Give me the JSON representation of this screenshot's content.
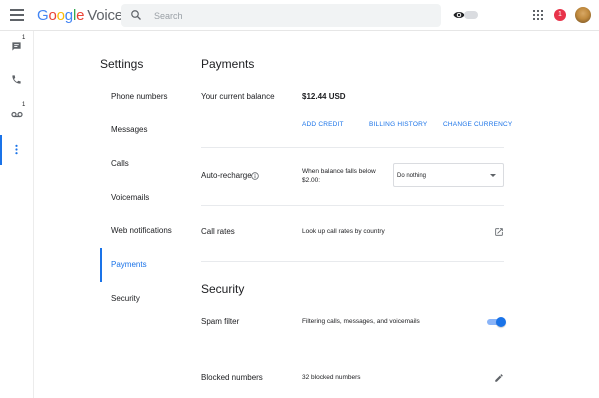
{
  "app": {
    "logo_letters": [
      "G",
      "o",
      "o",
      "g",
      "l",
      "e"
    ],
    "product": "Voice"
  },
  "search": {
    "placeholder": "Search"
  },
  "header": {
    "notification_count": "1"
  },
  "rail": {
    "messages_count": "1",
    "voicemail_count": "1"
  },
  "settings": {
    "title": "Settings",
    "nav": [
      "Phone numbers",
      "Messages",
      "Calls",
      "Voicemails",
      "Web notifications",
      "Payments",
      "Security"
    ],
    "active": "Payments"
  },
  "payments": {
    "title": "Payments",
    "balance_label": "Your current balance",
    "balance_value": "$12.44 USD",
    "links": {
      "add_credit": "ADD CREDIT",
      "billing_history": "BILLING HISTORY",
      "change_currency": "CHANGE CURRENCY"
    },
    "auto_recharge": {
      "label": "Auto-recharge",
      "description": "When balance falls below $2.00:",
      "selected": "Do nothing"
    },
    "call_rates": {
      "label": "Call rates",
      "description": "Look up call rates by country"
    }
  },
  "security": {
    "title": "Security",
    "spam_filter": {
      "label": "Spam filter",
      "description": "Filtering calls, messages, and voicemails",
      "enabled": true
    },
    "blocked": {
      "label": "Blocked numbers",
      "description": "32 blocked numbers"
    }
  },
  "colors": {
    "accent": "#1a73e8",
    "badge": "#e8334a"
  },
  "icons": [
    "menu-icon",
    "search-icon",
    "eye-icon",
    "apps-icon",
    "messages-icon",
    "calls-icon",
    "voicemail-icon",
    "more-icon",
    "info-icon",
    "open-in-new-icon",
    "edit-icon"
  ]
}
